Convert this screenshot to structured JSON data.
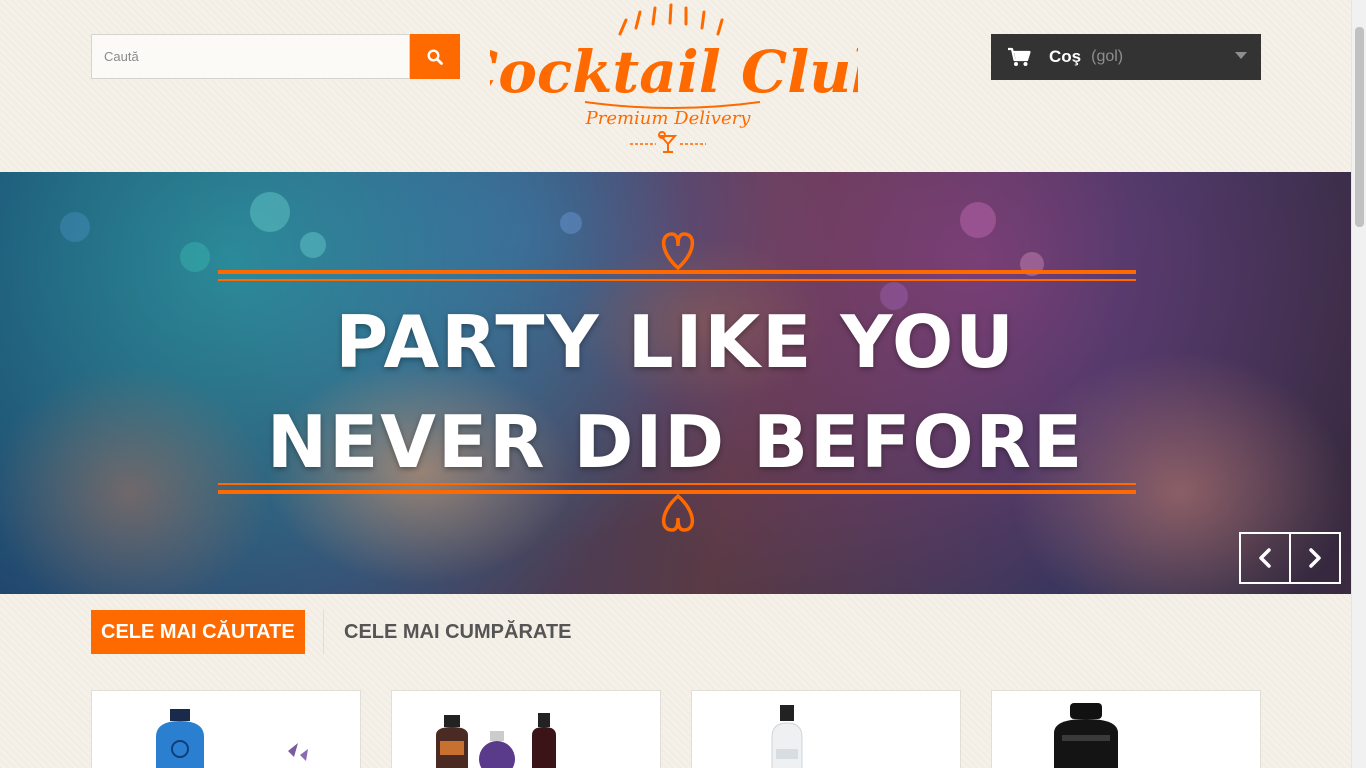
{
  "search": {
    "placeholder": "Caută",
    "icon": "search-icon"
  },
  "logo": {
    "title": "Cocktail Club",
    "tagline": "Premium Delivery"
  },
  "cart": {
    "label": "Coş",
    "status": "(gol)",
    "icon": "shopping-cart-icon"
  },
  "banner": {
    "line1": "PARTY LIKE YOU",
    "line2": "NEVER DID BEFORE",
    "prev_icon": "chevron-left-icon",
    "next_icon": "chevron-right-icon"
  },
  "tabs": [
    {
      "label": "CELE MAI CĂUTATE",
      "active": true
    },
    {
      "label": "CELE MAI CUMPĂRATE",
      "active": false
    }
  ],
  "products": [
    {
      "name": ""
    },
    {
      "name": ""
    },
    {
      "name": ""
    },
    {
      "name": ""
    }
  ],
  "colors": {
    "accent": "#ff6a00",
    "cart_bg": "#333333"
  }
}
